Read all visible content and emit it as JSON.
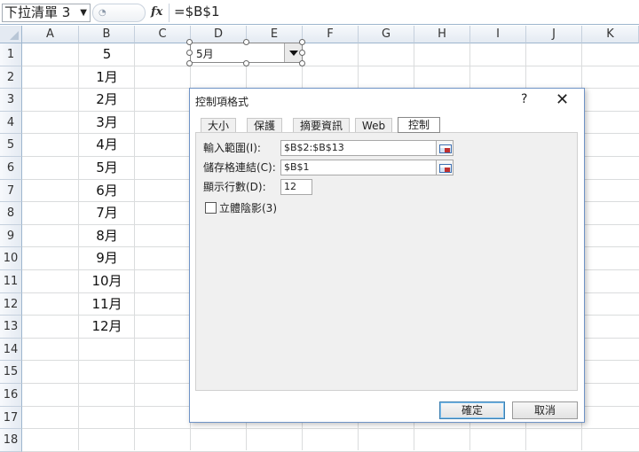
{
  "formula_bar": {
    "name_box": "下拉清單 3",
    "fx_label": "fx",
    "formula": "=$B$1"
  },
  "columns": [
    "A",
    "B",
    "C",
    "D",
    "E",
    "F",
    "G",
    "H",
    "I",
    "J",
    "K"
  ],
  "rows": [
    "1",
    "2",
    "3",
    "4",
    "5",
    "6",
    "7",
    "8",
    "9",
    "10",
    "11",
    "12",
    "13",
    "14",
    "15",
    "16",
    "17",
    "18"
  ],
  "column_b": [
    "5",
    "1月",
    "2月",
    "3月",
    "4月",
    "5月",
    "6月",
    "7月",
    "8月",
    "9月",
    "10月",
    "11月",
    "12月"
  ],
  "combo_box": {
    "value": "5月"
  },
  "dialog": {
    "title": "控制項格式",
    "help": "?",
    "close": "✕",
    "tabs": [
      "大小",
      "保護",
      "摘要資訊",
      "Web",
      "控制"
    ],
    "active_tab": "控制",
    "input_range_label": "輸入範圍(I):",
    "input_range_value": "$B$2:$B$13",
    "cell_link_label": "儲存格連結(C):",
    "cell_link_value": "$B$1",
    "drop_lines_label": "顯示行數(D):",
    "drop_lines_value": "12",
    "shading_label": "立體陰影(3)",
    "ok": "確定",
    "cancel": "取消"
  }
}
